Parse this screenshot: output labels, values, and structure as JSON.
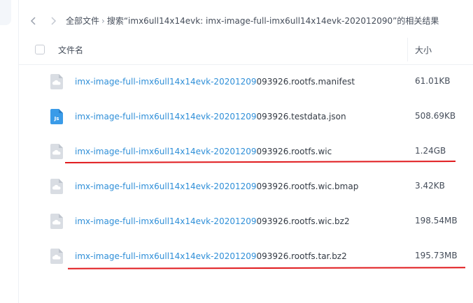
{
  "breadcrumb": {
    "root": "全部文件",
    "search": "搜索“imx6ull14x14evk: imx-image-full-imx6ull14x14evk-202012090”的相关结果"
  },
  "table": {
    "col_name": "文件名",
    "col_size": "大小",
    "rows": [
      {
        "hl": "imx-image-full-imx6ull14x14evk-20201209",
        "rest": "093926.rootfs.manifest",
        "size": "61.01KB",
        "icon": "generic-file-icon"
      },
      {
        "hl": "imx-image-full-imx6ull14x14evk-20201209",
        "rest": "093926.testdata.json",
        "size": "508.69KB",
        "icon": "js-file-icon"
      },
      {
        "hl": "imx-image-full-imx6ull14x14evk-20201209",
        "rest": "093926.rootfs.wic",
        "size": "1.24GB",
        "icon": "generic-file-icon"
      },
      {
        "hl": "imx-image-full-imx6ull14x14evk-20201209",
        "rest": "093926.rootfs.wic.bmap",
        "size": "3.42KB",
        "icon": "generic-file-icon"
      },
      {
        "hl": "imx-image-full-imx6ull14x14evk-20201209",
        "rest": "093926.rootfs.wic.bz2",
        "size": "198.54MB",
        "icon": "generic-file-icon"
      },
      {
        "hl": "imx-image-full-imx6ull14x14evk-20201209",
        "rest": "093926.rootfs.tar.bz2",
        "size": "195.73MB",
        "icon": "generic-file-icon"
      }
    ]
  },
  "colors": {
    "highlight": "#2f8fd8",
    "annotation": "#e0191c"
  }
}
